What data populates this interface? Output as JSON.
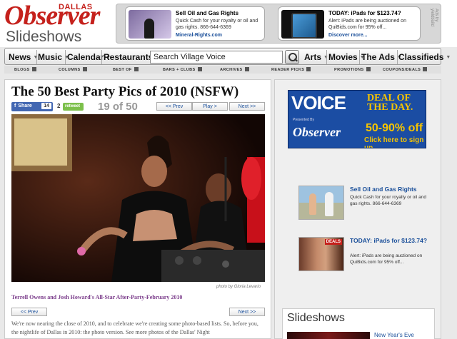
{
  "header": {
    "logo_dallas": "DALLAS",
    "logo_name": "Observer",
    "section_title": "Slideshows",
    "adchoices": "Ads by yieldbuild",
    "ads": [
      {
        "title": "Sell Oil and Gas Rights",
        "body": "Quick Cash for your royalty or oil and gas rights. 866-644-6369",
        "link": "Mineral-Rights.com"
      },
      {
        "title": "TODAY: iPads for $123.74?",
        "body": "Alert: iPads are being auctioned on QuiBids.com for 95% off...",
        "link": "Discover more..."
      }
    ]
  },
  "nav": {
    "items": [
      {
        "label": "News"
      },
      {
        "label": "Music"
      },
      {
        "label": "Calendar"
      },
      {
        "label": "Restaurants"
      },
      {
        "label": "Arts"
      },
      {
        "label": "Movies"
      },
      {
        "label": "The Ads"
      },
      {
        "label": "Classifieds"
      }
    ],
    "search_value": "Search Village Voice",
    "sub_items": [
      "BLOGS",
      "COLUMNS",
      "BEST OF",
      "BARS + CLUBS",
      "ARCHIVES",
      "READER PICKS",
      "PROMOTIONS",
      "COUPONS/DEALS"
    ]
  },
  "article": {
    "title": "The 50 Best Party Pics of 2010 (NSFW)",
    "share_label": "Share",
    "share_count": "14",
    "retweet_count": "2",
    "retweet_label": "retweet",
    "counter": "19 of 50",
    "prev": "<< Prev",
    "play": "Play >",
    "next": "Next >>",
    "photo_credit": "photo by Gloria Levario",
    "caption": "Terrell Owens and Josh Howard's All-Star After-Party-February 2010",
    "body": "We're now nearing the close of 2010, and to celebrate we're creating some photo-based lists. So, before you, the nightlife of Dallas in 2010: the photo version. See more photos of the Dallas' Night"
  },
  "sidebar": {
    "promo": {
      "voice": "VOICE",
      "deal": "DEAL OF THE DAY.",
      "presented": "Presented By",
      "logo_dallas": "DALLAS",
      "logo": "Observer",
      "percent": "50-90% off",
      "cta": "Click here to sign up."
    },
    "ads": [
      {
        "title": "Sell Oil and Gas Rights",
        "body": "Quick Cash for your royalty or oil and gas rights. 866-644-6369"
      },
      {
        "title": "TODAY: iPads for $123.74?",
        "body": "Alert: iPads are being auctioned on QuiBids.com for 95% off...",
        "badge": "DEALS"
      }
    ],
    "slideshows": {
      "title": "Slideshows",
      "item": "New Year's Eve"
    }
  }
}
